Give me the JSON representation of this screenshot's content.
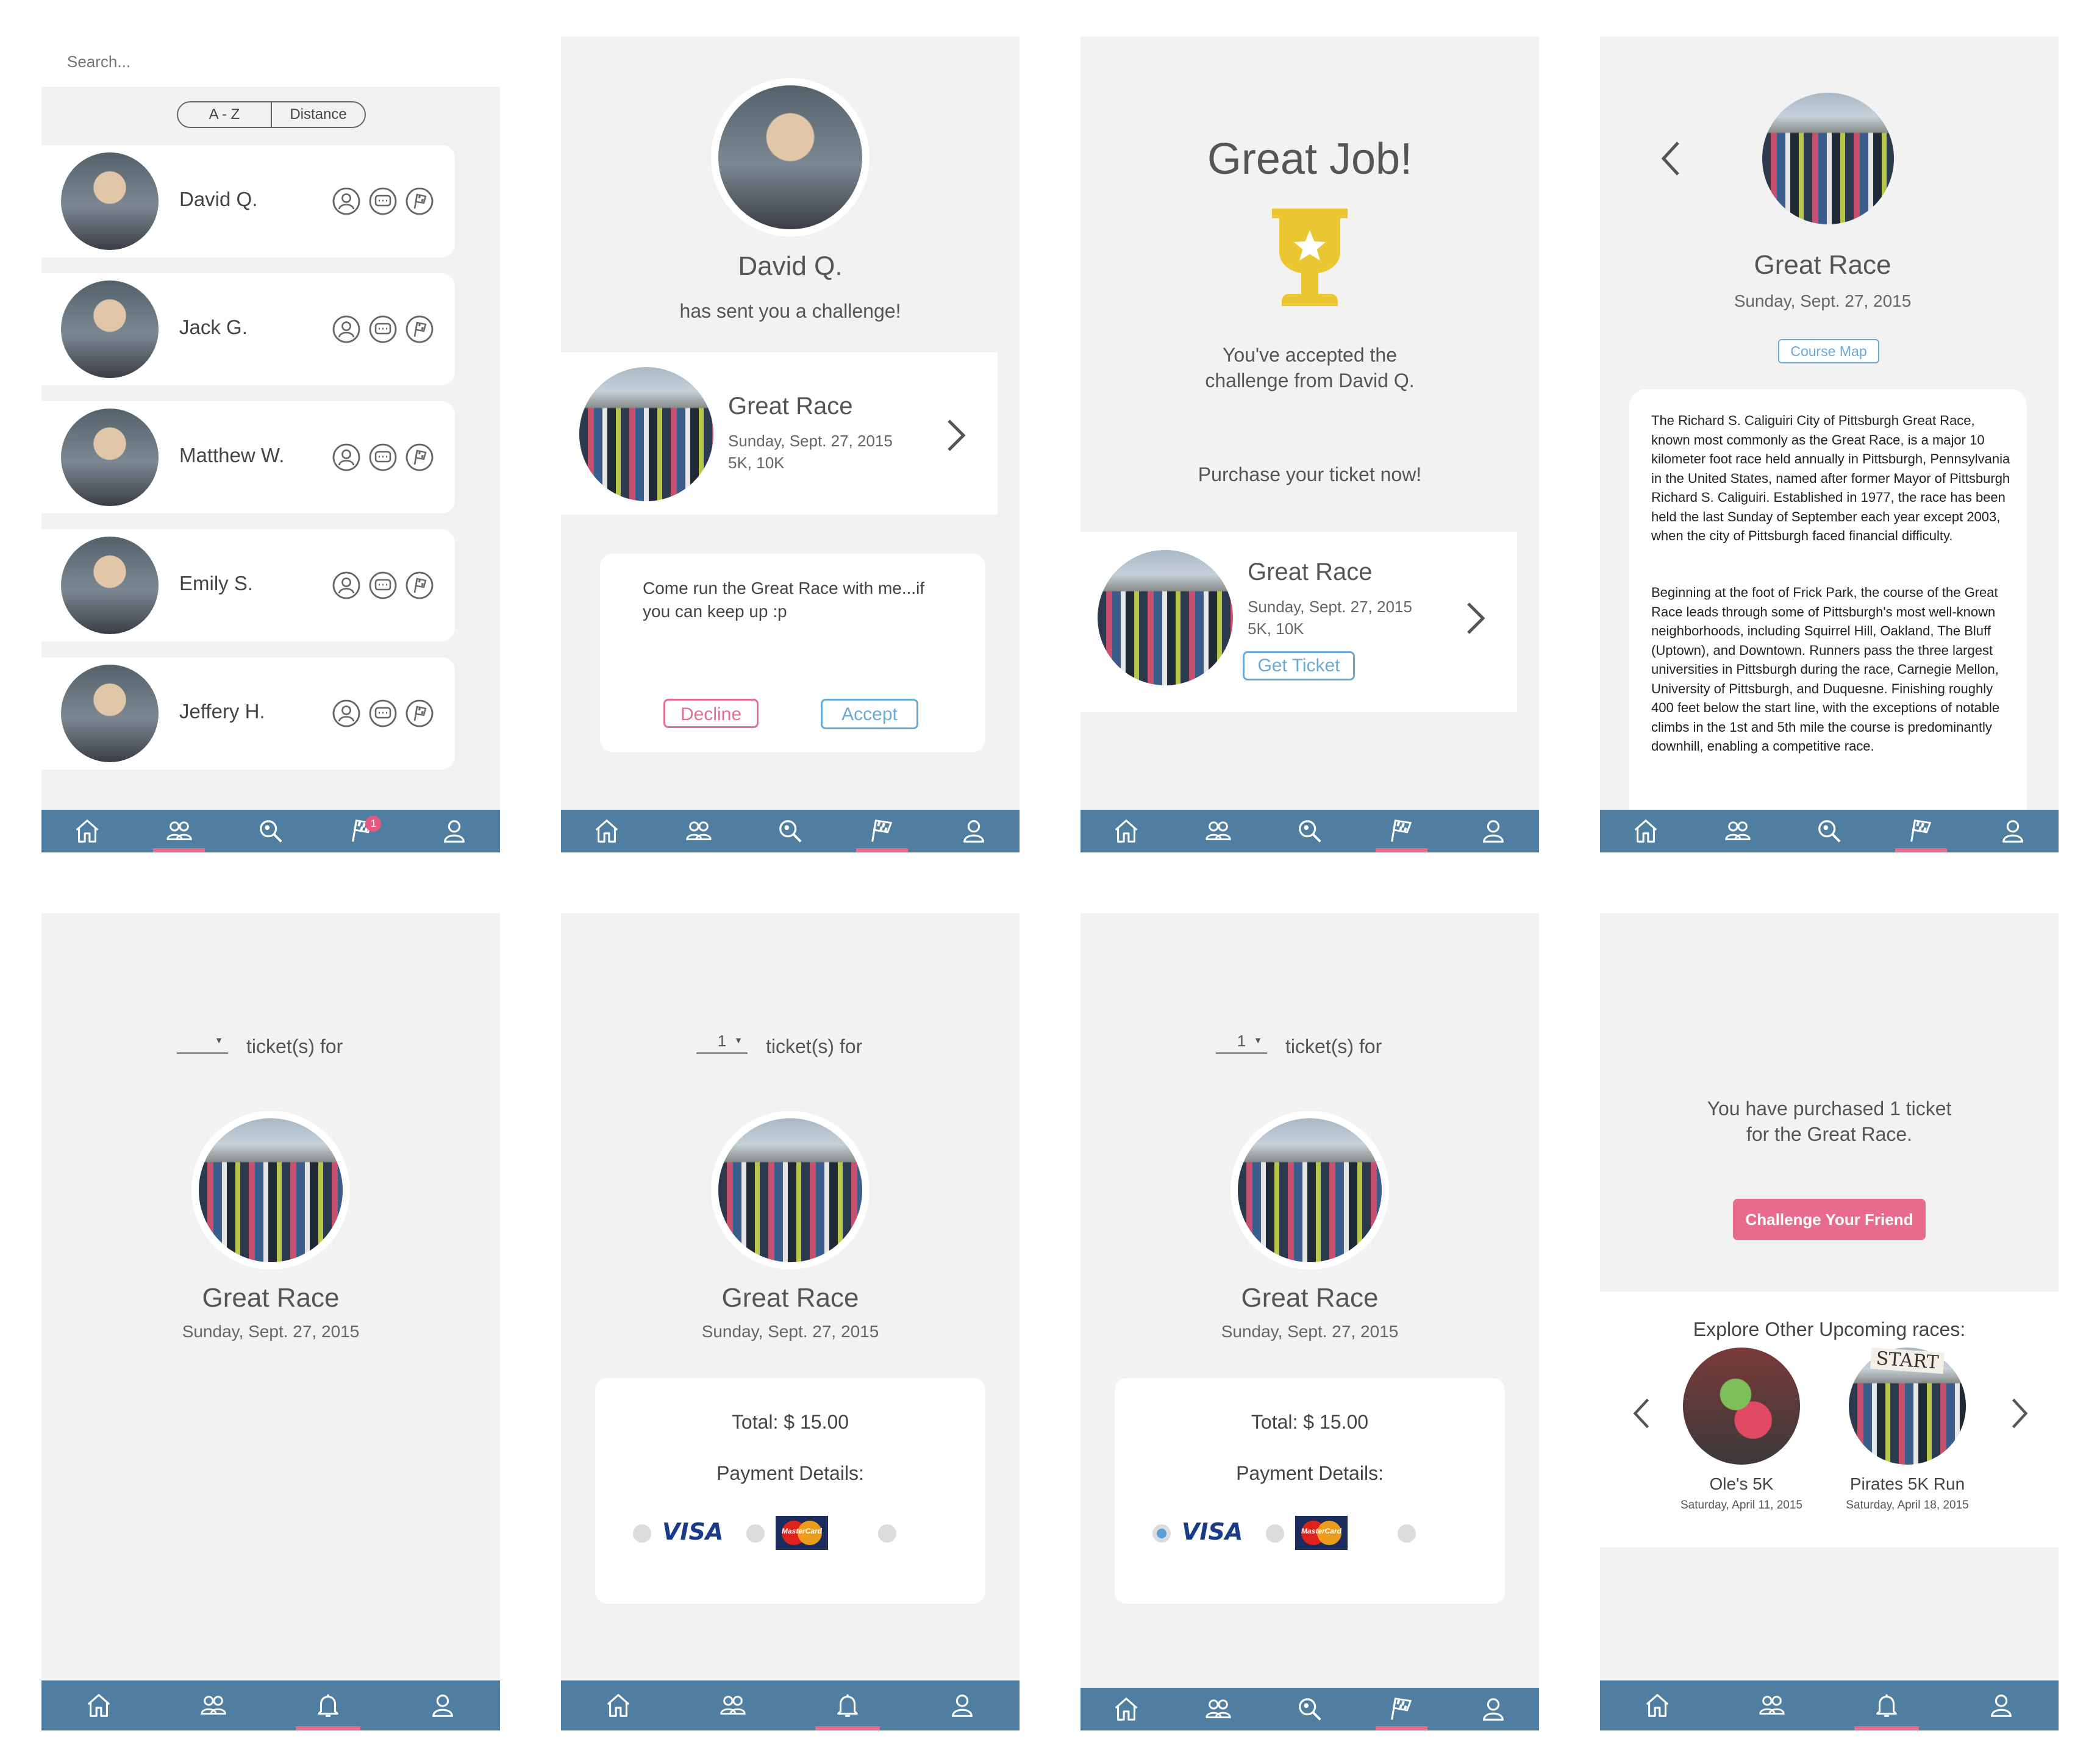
{
  "colors": {
    "nav": "#4f7ea0",
    "accent_pink": "#e86a8c",
    "accent_blue": "#5b9fd8",
    "trophy": "#ecc734",
    "bg": "#f2f2f2"
  },
  "friends_screen": {
    "search_placeholder": "Search...",
    "sort_az": "A - Z",
    "sort_distance": "Distance",
    "friends": [
      {
        "name": "David Q."
      },
      {
        "name": "Jack G."
      },
      {
        "name": "Matthew W."
      },
      {
        "name": "Emily S."
      },
      {
        "name": "Jeffery H."
      }
    ],
    "notification_count": "1"
  },
  "challenge_screen": {
    "sender": "David Q.",
    "subtitle": "has sent you a challenge!",
    "race_name": "Great Race",
    "race_date": "Sunday, Sept. 27, 2015",
    "race_distances": "5K, 10K",
    "message": "Come run the Great Race with me...if you can keep up :p",
    "decline": "Decline",
    "accept": "Accept"
  },
  "accepted_screen": {
    "title": "Great Job!",
    "line1": "You've accepted the",
    "line2": "challenge from David Q.",
    "purchase": "Purchase your ticket now!",
    "race_name": "Great Race",
    "race_date": "Sunday, Sept. 27, 2015",
    "race_distances": "5K, 10K",
    "get_ticket": "Get Ticket"
  },
  "race_detail_screen": {
    "race_name": "Great Race",
    "race_date": "Sunday, Sept. 27, 2015",
    "course_map": "Course Map",
    "para1": "The Richard S. Caliguiri City of Pittsburgh Great Race, known most commonly as the Great Race, is a major 10 kilometer foot race held annually in Pittsburgh, Pennsylvania in the United States, named after former Mayor of Pittsburgh Richard S. Caliguiri. Established in 1977, the race has been held the last Sunday of September each year except 2003, when the city of Pittsburgh faced financial difficulty.",
    "para2": "Beginning at the foot of Frick Park, the course of the Great Race leads through some of Pittsburgh's most well-known neighborhoods, including Squirrel Hill, Oakland, The Bluff (Uptown), and Downtown. Runners pass the three largest universities in Pittsburgh during the race, Carnegie Mellon, University of Pittsburgh, and Duquesne. Finishing roughly 400 feet below the start line, with the exceptions of notable climbs in the 1st and 5th mile the course is predominantly downhill, enabling a competitive race."
  },
  "ticket_screens": {
    "tickets_for": "ticket(s) for",
    "qty_empty": "",
    "qty_selected": "1",
    "race_name": "Great Race",
    "race_date": "Sunday, Sept. 27, 2015",
    "total": "Total: $ 15.00",
    "payment_details": "Payment Details:",
    "visa": "VISA",
    "mastercard": "MasterCard"
  },
  "purchased_screen": {
    "line1": "You have purchased 1 ticket",
    "line2": "for the Great Race.",
    "challenge_button": "Challenge Your Friend",
    "explore": "Explore Other Upcoming races:",
    "races": [
      {
        "name": "Ole's 5K",
        "date": "Saturday, April 11, 2015"
      },
      {
        "name": "Pirates 5K Run",
        "date": "Saturday, April 18, 2015"
      }
    ],
    "start_sign": "START"
  },
  "nav_icons": [
    "home-icon",
    "friends-icon",
    "search-icon",
    "race-flag-icon",
    "profile-icon"
  ],
  "nav_icons_alt": [
    "home-icon",
    "friends-icon",
    "bell-icon",
    "profile-icon"
  ]
}
